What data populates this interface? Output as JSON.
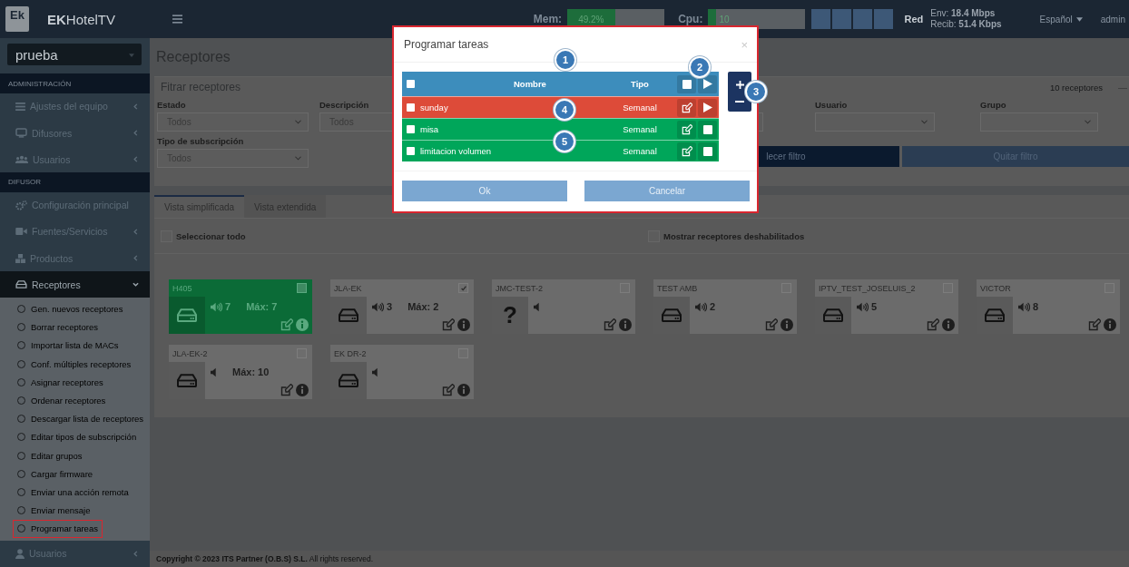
{
  "header": {
    "logo": "Ek",
    "app_name": "**EK**HotelTV",
    "mem": {
      "label": "Mem:",
      "level": 0.49,
      "reading": "49.2%"
    },
    "cpu": {
      "label": "Cpu:",
      "level": 0.08,
      "reading": "10"
    },
    "network": {
      "label": "Red",
      "sent": "Env: **18.4 Mbps**",
      "received": "Recib: **51.4 Kbps**"
    },
    "language": "Español",
    "user": "admin"
  },
  "sidebar": {
    "selector": "prueba",
    "items": [
      {
        "kind": "header",
        "label": "ADMINISTRACIÓN"
      },
      {
        "kind": "menu",
        "label": "Ajustes del equipo",
        "selected": false,
        "expanded": false
      },
      {
        "kind": "menu",
        "label": "Difusores",
        "selected": false,
        "expanded": false
      },
      {
        "kind": "menu",
        "label": "Usuarios",
        "selected": false,
        "expanded": false
      },
      {
        "kind": "header",
        "label": "DIFUSOR"
      },
      {
        "kind": "menu",
        "label": "Configuración principal",
        "selected": false
      },
      {
        "kind": "menu",
        "label": "Fuentes/Servicios",
        "selected": false,
        "expanded": false
      },
      {
        "kind": "menu",
        "label": "Productos",
        "selected": false,
        "expanded": false
      },
      {
        "kind": "menu",
        "label": "Receptores",
        "selected": true,
        "expanded": true,
        "children": [
          {
            "label": "Gen. nuevos receptores",
            "highlighted": false
          },
          {
            "label": "Borrar receptores",
            "highlighted": false
          },
          {
            "label": "Importar lista de MACs",
            "highlighted": false
          },
          {
            "label": "Conf. múltiples receptores",
            "highlighted": false
          },
          {
            "label": "Asignar receptores",
            "highlighted": false
          },
          {
            "label": "Ordenar receptores",
            "highlighted": false
          },
          {
            "label": "Descargar lista de receptores",
            "highlighted": false
          },
          {
            "label": "Editar tipos de subscripción",
            "highlighted": false
          },
          {
            "label": "Editar grupos",
            "highlighted": false
          },
          {
            "label": "Cargar firmware",
            "highlighted": false
          },
          {
            "label": "Enviar una acción remota",
            "highlighted": false
          },
          {
            "label": "Enviar mensaje",
            "highlighted": false
          },
          {
            "label": "Programar tareas",
            "highlighted": true
          }
        ]
      },
      {
        "kind": "menu",
        "label": "Usuarios",
        "selected": false,
        "expanded": false
      }
    ]
  },
  "page_title": "Receptores",
  "filter": {
    "title": "Fitrar receptores",
    "count": "10 receptores",
    "collapse": "—",
    "fields": [
      {
        "kind": "select",
        "label": "Estado",
        "value": "Todos"
      },
      {
        "kind": "select",
        "label": "Descripción",
        "value": "Todos"
      },
      {
        "kind": "select"
      },
      {
        "kind": "select",
        "label": "Usuario"
      },
      {
        "kind": "select",
        "label": "Grupo"
      },
      {
        "kind": "select",
        "label": "Tipo de subscripción",
        "value": "Todos"
      }
    ],
    "buttons": [
      {
        "kind": "primary",
        "label": "lecer filtro"
      },
      {
        "kind": "secondary",
        "label": "Quitar filtro"
      }
    ]
  },
  "tabs": [
    {
      "label": "Vista simplificada",
      "selected": true
    },
    {
      "label": "Vista extendida",
      "selected": false
    }
  ],
  "options": [
    {
      "label": "Seleccionar todo",
      "checked": false
    },
    {
      "label": "Mostrar receptores deshabilitados",
      "checked": false
    }
  ],
  "receivers": [
    {
      "name": "H405",
      "checked": false,
      "active": true,
      "volume": "7",
      "max": "Máx: 7"
    },
    {
      "name": "JLA-EK",
      "checked": true,
      "active": false,
      "volume": "3",
      "max": "Máx: 2"
    },
    {
      "name": "JMC-TEST-2",
      "checked": false,
      "active": false,
      "glyph": "?"
    },
    {
      "name": "TEST AMB",
      "checked": false,
      "active": false,
      "volume": "2"
    },
    {
      "name": "IPTV_TEST_JOSELUIS_2",
      "checked": false,
      "active": false,
      "volume": "5"
    },
    {
      "name": "VICTOR",
      "checked": false,
      "active": false,
      "volume": "8"
    },
    {
      "name": "JLA-EK-2",
      "checked": false,
      "active": false,
      "max": "Máx: 10"
    },
    {
      "name": "EK DR-2",
      "checked": false,
      "active": false
    }
  ],
  "footer": "**Copyright © 2023 ITS Partner (O.B.S) S.L.** All rights reserved.",
  "modal": {
    "title": "Programar tareas",
    "close": "×",
    "columns": [
      "Nombre",
      "Tipo"
    ],
    "all_checked": false,
    "tasks": [
      {
        "name": "sunday",
        "type": "Semanal",
        "checked": false,
        "running": false
      },
      {
        "name": "misa",
        "type": "Semanal",
        "checked": false,
        "running": true
      },
      {
        "name": "limitacion volumen",
        "type": "Semanal",
        "checked": false,
        "running": true
      }
    ],
    "buttons": [
      "Ok",
      "Cancelar"
    ],
    "callouts": [
      "1",
      "2",
      "3",
      "4",
      "5"
    ]
  }
}
